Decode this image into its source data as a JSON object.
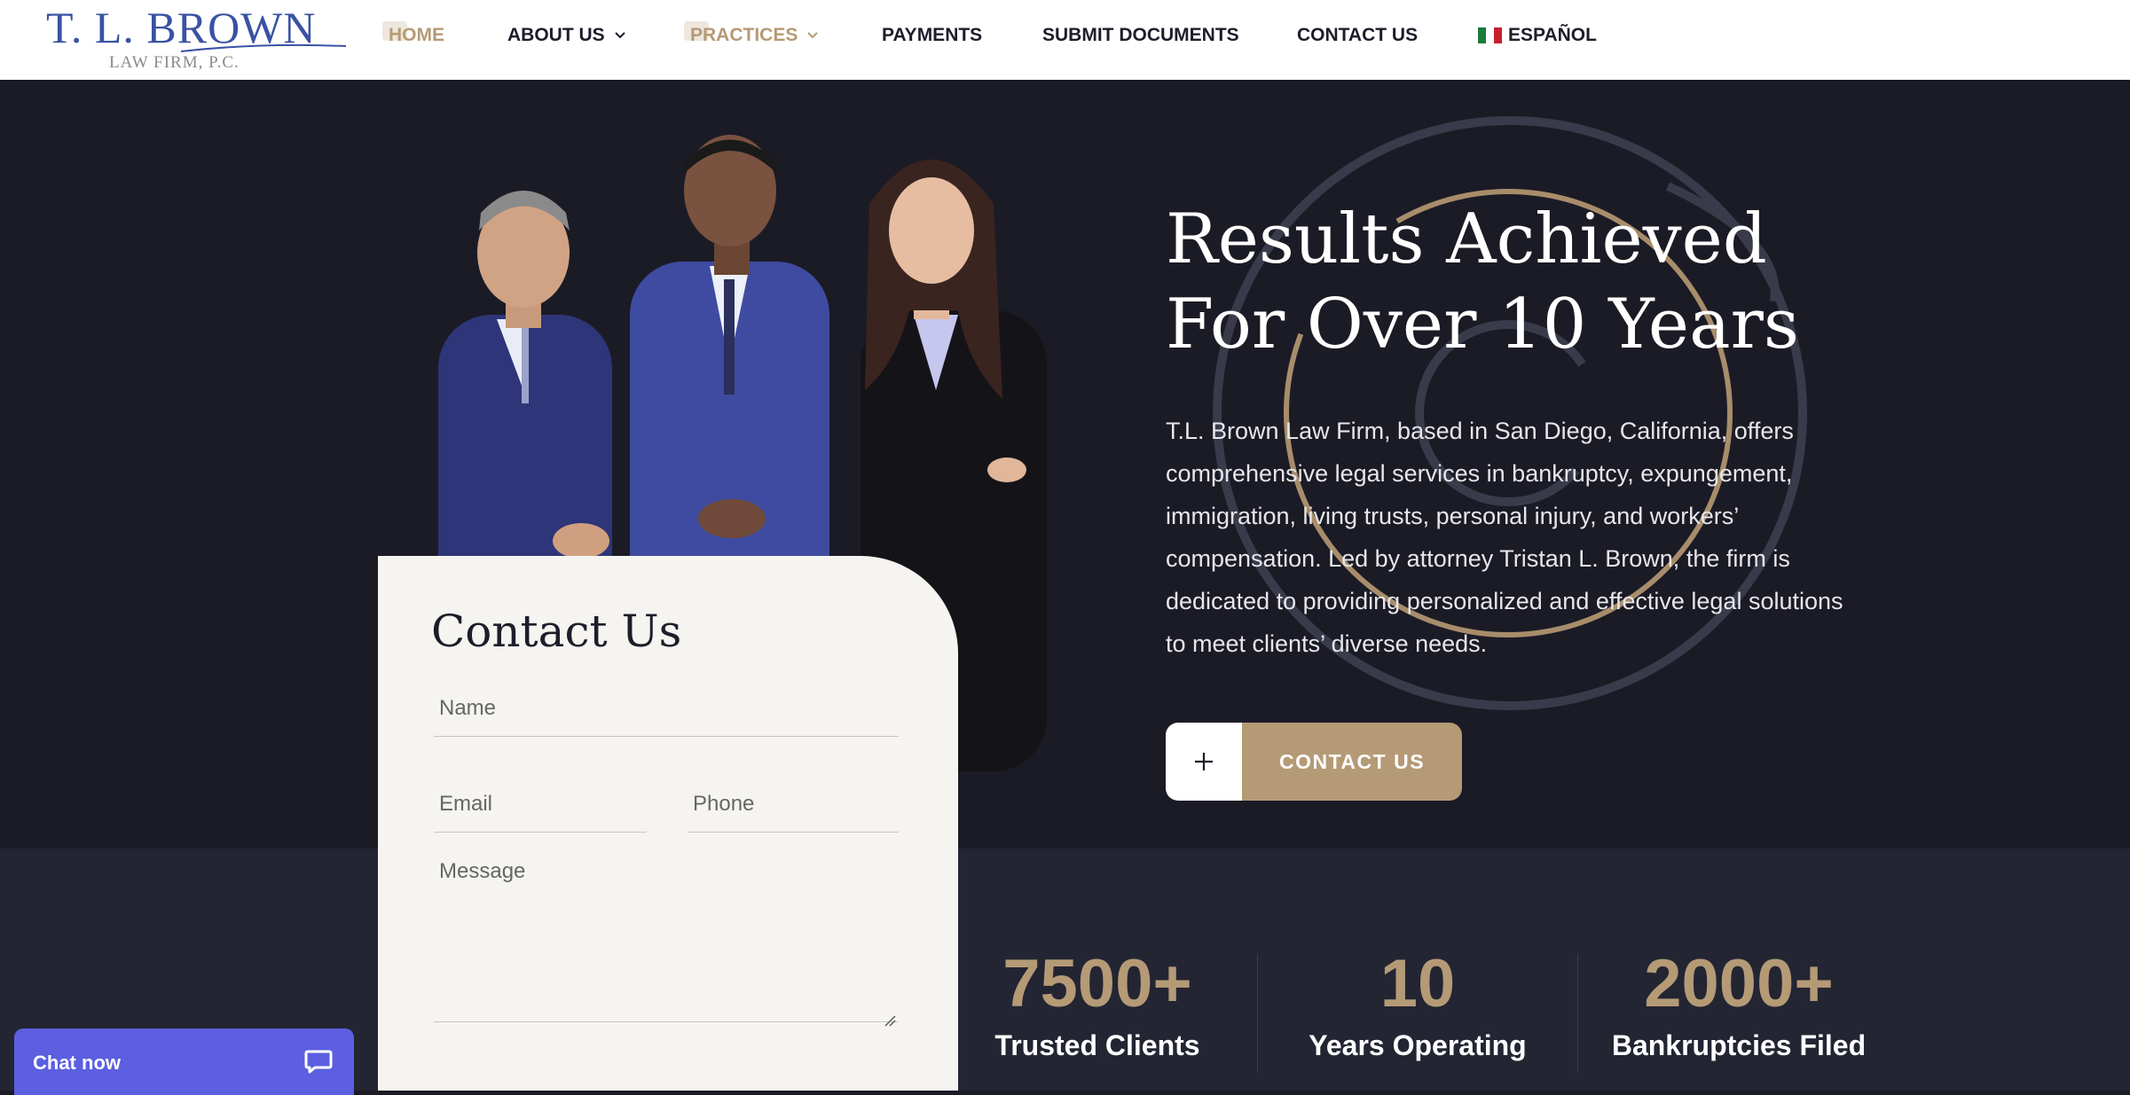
{
  "header": {
    "logo_main": "T. L. BROWN",
    "logo_sub": "LAW FIRM, P.C.",
    "nav": [
      {
        "label": "HOME"
      },
      {
        "label": "ABOUT US"
      },
      {
        "label": "PRACTICES"
      },
      {
        "label": "PAYMENTS"
      },
      {
        "label": "SUBMIT DOCUMENTS"
      },
      {
        "label": "CONTACT US"
      },
      {
        "label": "ESPAÑOL"
      }
    ]
  },
  "hero": {
    "title": "Results Achieved For Over 10 Years",
    "description": "T.L. Brown Law Firm, based in San Diego, California, offers comprehensive legal services in bankruptcy, expungement, immigration, living trusts, personal injury, and workers’ compensation. Led by attorney Tristan L. Brown, the firm is dedicated to providing personalized and effective legal solutions to meet clients’ diverse needs.",
    "cta_label": "CONTACT US",
    "cta_icon": "plus-icon"
  },
  "contact_form": {
    "title": "Contact Us",
    "name_placeholder": "Name",
    "email_placeholder": "Email",
    "phone_placeholder": "Phone",
    "message_placeholder": "Message"
  },
  "stats": [
    {
      "number": "7500+",
      "label": "Trusted Clients"
    },
    {
      "number": "10",
      "label": "Years Operating"
    },
    {
      "number": "2000+",
      "label": "Bankruptcies Filed"
    }
  ],
  "chat": {
    "label": "Chat now",
    "icon": "chat-bubble-icon"
  },
  "colors": {
    "brand_blue": "#3a52a3",
    "accent_gold": "#b59a76",
    "hero_bg": "#1b1b26",
    "stats_bg": "#232533",
    "form_bg": "#f6f4f1",
    "chat_bg": "#5b5fe0"
  }
}
